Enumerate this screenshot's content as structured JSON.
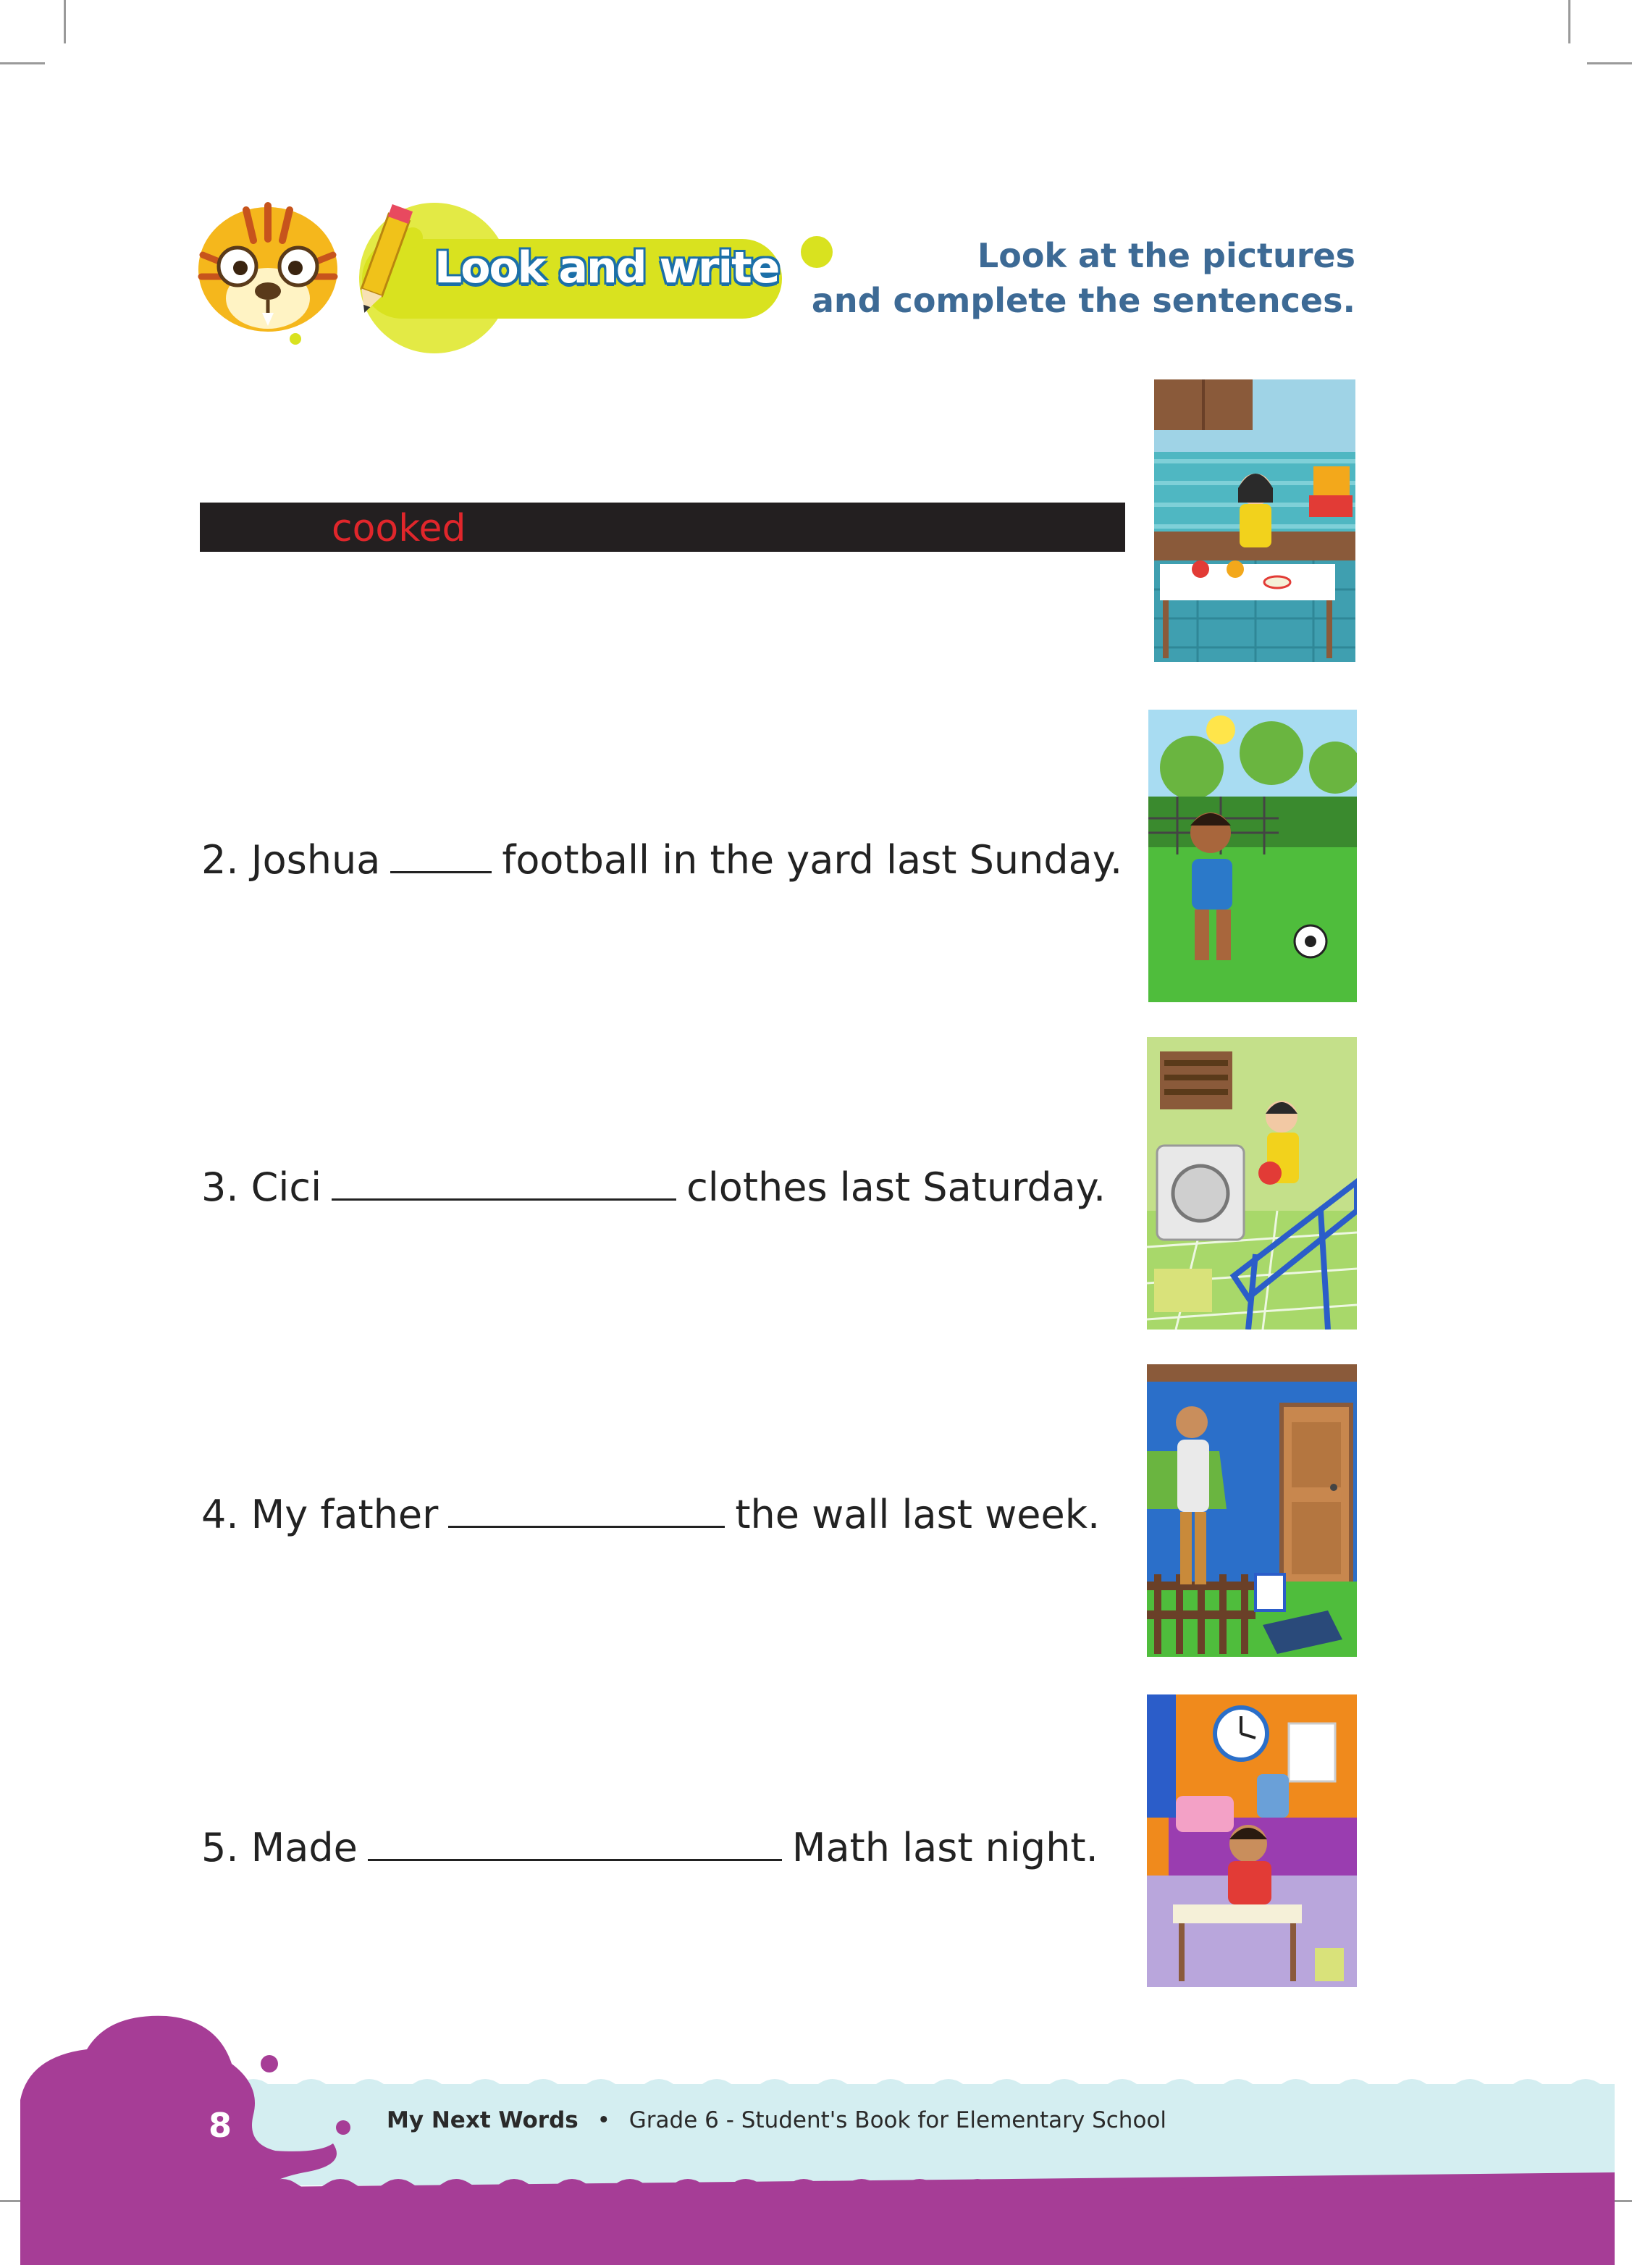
{
  "header": {
    "title": "Look and write",
    "instruction_line1": "Look at the pictures",
    "instruction_line2": "and complete the sentences."
  },
  "exercise": {
    "item1_answer": "cooked",
    "item2": {
      "before": "2. Joshua",
      "after": "football in the yard last Sunday."
    },
    "item3": {
      "before": "3. Cici",
      "after": "clothes last Saturday."
    },
    "item4": {
      "before": "4. My father",
      "after": "the wall last week."
    },
    "item5": {
      "before": "5. Made",
      "after": "Math last night."
    }
  },
  "footer": {
    "page_number": "8",
    "book_title": "My Next Words",
    "separator": "•",
    "subtitle": "Grade 6 - Student's Book for Elementary School"
  },
  "colors": {
    "title_blue": "#1b6fa8",
    "instruction_blue": "#3d6a95",
    "answer_red": "#e0262b",
    "footer_purple": "#a63d96",
    "footer_wave": "#d4eef1",
    "lime": "#d9e21f"
  },
  "icons": [
    "tiger-mascot-icon",
    "pencil-icon"
  ]
}
